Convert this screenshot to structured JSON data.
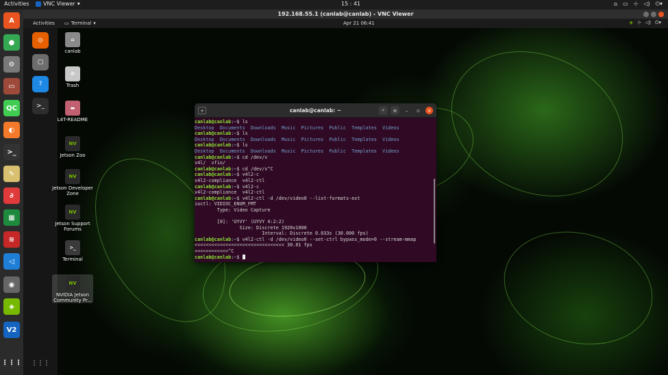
{
  "host": {
    "activities": "Activities",
    "app_name": "VNC Viewer",
    "clock": "15 : 41",
    "window_title": "192.168.55.1 (canlab@canlab) - VNC Viewer",
    "dock": [
      {
        "name": "ubuntu-software-icon",
        "glyph": "A",
        "color": "#e95420"
      },
      {
        "name": "chrome-icon",
        "glyph": "●",
        "color": "#34a853"
      },
      {
        "name": "settings-icon",
        "glyph": "⚙",
        "color": "#7a7a7a"
      },
      {
        "name": "files-drawer-icon",
        "glyph": "▭",
        "color": "#9e4a3a"
      },
      {
        "name": "qt-creator-icon",
        "glyph": "QC",
        "color": "#41cd52"
      },
      {
        "name": "blender-icon",
        "glyph": "◐",
        "color": "#f5792a"
      },
      {
        "name": "terminal-icon",
        "glyph": ">_",
        "color": "#333333"
      },
      {
        "name": "text-editor-icon",
        "glyph": "✎",
        "color": "#d8c070"
      },
      {
        "name": "app-red-icon",
        "glyph": "∂",
        "color": "#e03a3a"
      },
      {
        "name": "spreadsheet-icon",
        "glyph": "▦",
        "color": "#1e8a3e"
      },
      {
        "name": "app-red2-icon",
        "glyph": "≋",
        "color": "#c62828"
      },
      {
        "name": "vscode-icon",
        "glyph": "◁",
        "color": "#1f7fd6"
      },
      {
        "name": "camera-icon",
        "glyph": "◉",
        "color": "#666666"
      },
      {
        "name": "nvidia-icon",
        "glyph": "◈",
        "color": "#76b900"
      },
      {
        "name": "vnc-viewer-icon",
        "glyph": "V2",
        "color": "#1565c0"
      },
      {
        "name": "app-grid-icon",
        "glyph": "⋮⋮⋮",
        "color": "transparent"
      }
    ]
  },
  "remote": {
    "activities": "Activities",
    "app_name": "Terminal",
    "clock": "Apr 21  06:41",
    "dock": [
      {
        "name": "firefox-icon",
        "glyph": "◎",
        "color": "#e66000"
      },
      {
        "name": "files-icon",
        "glyph": "▢",
        "color": "#6d6d6d"
      },
      {
        "name": "help-icon",
        "glyph": "?",
        "color": "#1e88e5"
      },
      {
        "name": "terminal-icon",
        "glyph": ">_",
        "color": "#2d2d2d"
      },
      {
        "name": "app-grid-icon",
        "glyph": "⋮⋮⋮",
        "color": "transparent"
      }
    ],
    "desktop_icons": [
      {
        "name": "desktop-icon-canlab",
        "label": "canlab",
        "glyph": "⌂",
        "color": "#8a8a8a"
      },
      {
        "name": "desktop-icon-trash",
        "label": "Trash",
        "glyph": "♻",
        "color": "#c8c8c8"
      },
      {
        "name": "desktop-icon-l4t-readme",
        "label": "L4T-README",
        "glyph": "▬",
        "color": "#c06070"
      },
      {
        "name": "desktop-icon-jetson-zoo",
        "label": "Jetson Zoo",
        "glyph": "NV",
        "color": "#2a2a2a"
      },
      {
        "name": "desktop-icon-jetson-developer-zone",
        "label": "Jetson Developer Zone",
        "glyph": "NV",
        "color": "#2a2a2a"
      },
      {
        "name": "desktop-icon-jetson-support-forums",
        "label": "Jetson Support Forums",
        "glyph": "NV",
        "color": "#2a2a2a"
      },
      {
        "name": "desktop-icon-terminal",
        "label": "Terminal",
        "glyph": ">_",
        "color": "#3a3a3a"
      },
      {
        "name": "desktop-icon-nvidia-community",
        "label": "NVIDIA Jetson Community Pr...",
        "glyph": "NV",
        "color": "#2a2a2a"
      }
    ]
  },
  "terminal": {
    "title": "canlab@canlab: ~",
    "lines": [
      [
        {
          "t": "canlab@canlab",
          "c": "prompt"
        },
        {
          "t": ":",
          "c": ""
        },
        {
          "t": "~",
          "c": "path"
        },
        {
          "t": "$ ls",
          "c": ""
        }
      ],
      [
        {
          "t": "Desktop  Documents  Downloads  Music  Pictures  Public  Templates  Videos",
          "c": "dir"
        }
      ],
      [
        {
          "t": "canlab@canlab",
          "c": "prompt"
        },
        {
          "t": ":",
          "c": ""
        },
        {
          "t": "~",
          "c": "path"
        },
        {
          "t": "$ ls",
          "c": ""
        }
      ],
      [
        {
          "t": "Desktop  Documents  Downloads  Music  Pictures  Public  Templates  Videos",
          "c": "dir"
        }
      ],
      [
        {
          "t": "canlab@canlab",
          "c": "prompt"
        },
        {
          "t": ":",
          "c": ""
        },
        {
          "t": "~",
          "c": "path"
        },
        {
          "t": "$ ls",
          "c": ""
        }
      ],
      [
        {
          "t": "Desktop  Documents  Downloads  Music  Pictures  Public  Templates  Videos",
          "c": "dir"
        }
      ],
      [
        {
          "t": "canlab@canlab",
          "c": "prompt"
        },
        {
          "t": ":",
          "c": ""
        },
        {
          "t": "~",
          "c": "path"
        },
        {
          "t": "$ cd /dev/v",
          "c": ""
        }
      ],
      [
        {
          "t": "v4l/  vfio/",
          "c": ""
        }
      ],
      [
        {
          "t": "canlab@canlab",
          "c": "prompt"
        },
        {
          "t": ":",
          "c": ""
        },
        {
          "t": "~",
          "c": "path"
        },
        {
          "t": "$ cd /dev/v^C",
          "c": ""
        }
      ],
      [
        {
          "t": "canlab@canlab",
          "c": "prompt"
        },
        {
          "t": ":",
          "c": ""
        },
        {
          "t": "~",
          "c": "path"
        },
        {
          "t": "$ v4l2-c",
          "c": ""
        }
      ],
      [
        {
          "t": "v4l2-compliance  v4l2-ctl",
          "c": ""
        }
      ],
      [
        {
          "t": "canlab@canlab",
          "c": "prompt"
        },
        {
          "t": ":",
          "c": ""
        },
        {
          "t": "~",
          "c": "path"
        },
        {
          "t": "$ v4l2-c",
          "c": ""
        }
      ],
      [
        {
          "t": "v4l2-compliance  v4l2-ctl",
          "c": ""
        }
      ],
      [
        {
          "t": "canlab@canlab",
          "c": "prompt"
        },
        {
          "t": ":",
          "c": ""
        },
        {
          "t": "~",
          "c": "path"
        },
        {
          "t": "$ v4l2-ctl -d /dev/video0 --list-formats-ext",
          "c": ""
        }
      ],
      [
        {
          "t": "ioctl: VIDIOC_ENUM_FMT",
          "c": ""
        }
      ],
      [
        {
          "t": "        Type: Video Capture",
          "c": ""
        }
      ],
      [
        {
          "t": "",
          "c": ""
        }
      ],
      [
        {
          "t": "        [0]: 'UYVY' (UYVY 4:2:2)",
          "c": ""
        }
      ],
      [
        {
          "t": "                Size: Discrete 1920x1080",
          "c": ""
        }
      ],
      [
        {
          "t": "                        Interval: Discrete 0.033s (30.000 fps)",
          "c": ""
        }
      ],
      [
        {
          "t": "canlab@canlab",
          "c": "prompt"
        },
        {
          "t": ":",
          "c": ""
        },
        {
          "t": "~",
          "c": "path"
        },
        {
          "t": "$ v4l2-ctl -d /dev/video0 --set-ctrl bypass_mode=0 --stream-mmap",
          "c": ""
        }
      ],
      [
        {
          "t": "<<<<<<<<<<<<<<<<<<<<<<<<<<<<<<<< 30.01 fps",
          "c": ""
        }
      ],
      [
        {
          "t": "<<<<<<<<<<<<^C",
          "c": ""
        }
      ],
      [
        {
          "t": "canlab@canlab",
          "c": "prompt"
        },
        {
          "t": ":",
          "c": ""
        },
        {
          "t": "~",
          "c": "path"
        },
        {
          "t": "$ ",
          "c": ""
        },
        {
          "t": "",
          "c": "cursor"
        }
      ]
    ]
  },
  "colors": {
    "terminal_bg": "#300a24",
    "prompt_green": "#8ae234",
    "dir_blue": "#729fcf",
    "ubuntu_orange": "#e95420"
  }
}
